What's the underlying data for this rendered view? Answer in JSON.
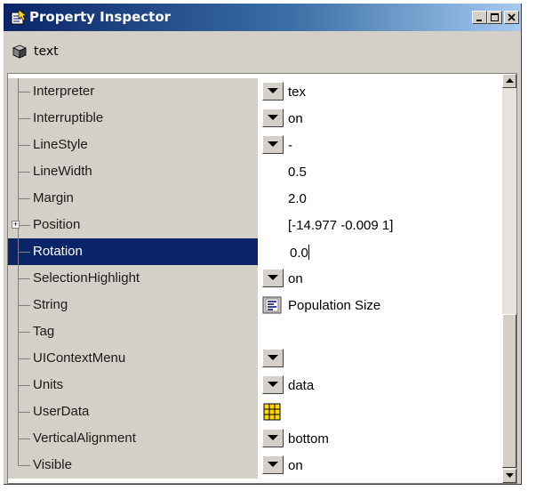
{
  "window": {
    "title": "Property Inspector",
    "buttons": [
      "minimize",
      "maximize",
      "close"
    ]
  },
  "object": {
    "type_label": "text"
  },
  "colors": {
    "title_gradient_start": "#0a246a",
    "selection": "#0a246a",
    "face": "#d4d0c8"
  },
  "properties": [
    {
      "name": "Interpreter",
      "value": "tex",
      "control": "dropdown"
    },
    {
      "name": "Interruptible",
      "value": "on",
      "control": "dropdown"
    },
    {
      "name": "LineStyle",
      "value": "-",
      "control": "dropdown"
    },
    {
      "name": "LineWidth",
      "value": "0.5",
      "control": "text"
    },
    {
      "name": "Margin",
      "value": "2.0",
      "control": "text"
    },
    {
      "name": "Position",
      "value": "[-14.977 -0.009 1]",
      "control": "text",
      "expandable": true
    },
    {
      "name": "Rotation",
      "value": "0.0",
      "control": "edit",
      "selected": true
    },
    {
      "name": "SelectionHighlight",
      "value": "on",
      "control": "dropdown"
    },
    {
      "name": "String",
      "value": "Population Size",
      "control": "text-editor",
      "icon": "text-editor-icon"
    },
    {
      "name": "Tag",
      "value": "",
      "control": "text"
    },
    {
      "name": "UIContextMenu",
      "value": "",
      "control": "dropdown"
    },
    {
      "name": "Units",
      "value": "data",
      "control": "dropdown"
    },
    {
      "name": "UserData",
      "value": "",
      "control": "matrix",
      "icon": "matrix-grid-icon"
    },
    {
      "name": "VerticalAlignment",
      "value": "bottom",
      "control": "dropdown"
    },
    {
      "name": "Visible",
      "value": "on",
      "control": "dropdown"
    }
  ]
}
